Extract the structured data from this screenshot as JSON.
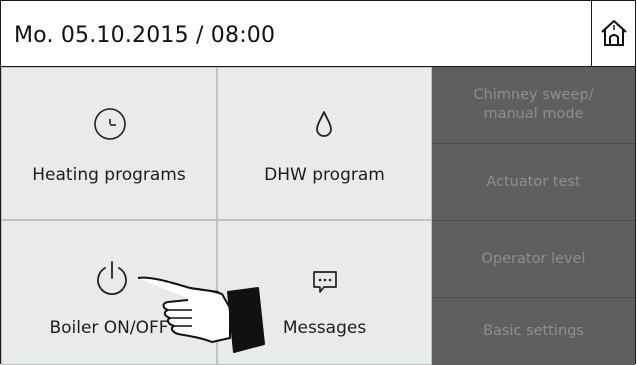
{
  "header": {
    "datetime": "Mo. 05.10.2015 / 08:00",
    "home_icon": "home-icon"
  },
  "tiles": [
    {
      "label": "Heating programs",
      "icon": "clock-icon"
    },
    {
      "label": "DHW program",
      "icon": "water-drop-icon"
    },
    {
      "label": "Boiler ON/OFF",
      "icon": "power-icon"
    },
    {
      "label": "Messages",
      "icon": "message-icon"
    }
  ],
  "side_menu": [
    {
      "label": "Chimney sweep/\nmanual mode"
    },
    {
      "label": "Actuator test"
    },
    {
      "label": "Operator level"
    },
    {
      "label": "Basic settings"
    }
  ],
  "colors": {
    "tile_bg": "#e9ebe8",
    "side_bg": "#5f5f5f",
    "side_text": "#8e8e8e"
  }
}
